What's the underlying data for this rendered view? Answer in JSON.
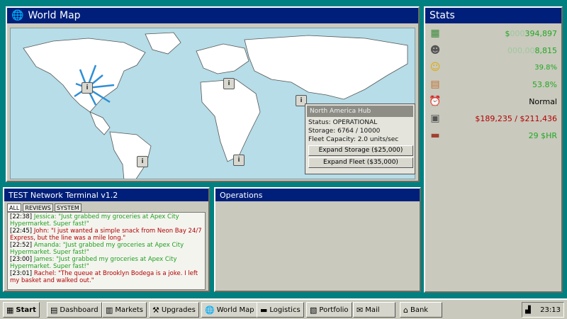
{
  "worldmap": {
    "title": "World Map",
    "popup": {
      "title": "North America Hub",
      "status": "Status: OPERATIONAL",
      "storage": "Storage: 6764 / 10000",
      "fleet": "Fleet Capacity: 2.0 units/sec",
      "expand_storage": "Expand Storage ($25,000)",
      "expand_fleet": "Expand Fleet ($35,000)"
    }
  },
  "stats": {
    "title": "Stats",
    "cash_prefix": "$",
    "cash_dim": "000",
    "cash_value": "394,897",
    "units_dim": "000,00",
    "units_value": "8,815",
    "happiness": "39.8%",
    "growth": "53.8%",
    "speed": "Normal",
    "storage": "$189,235 / $211,436",
    "rate": "29 $HR"
  },
  "terminal": {
    "title": "TEST Network Terminal v1.2",
    "tabs": [
      "ALL",
      "REVIEWS",
      "SYSTEM"
    ],
    "log": [
      {
        "time": "[22:38]",
        "text": "Jessica: \"Just grabbed my groceries at Apex City Hypermarket. Super fast!\"",
        "tone": "good"
      },
      {
        "time": "[22:45]",
        "text": "John: \"I just wanted a simple snack from Neon Bay 24/7 Express, but the line was a mile long.\"",
        "tone": "bad"
      },
      {
        "time": "[22:52]",
        "text": "Amanda: \"Just grabbed my groceries at Apex City Hypermarket. Super fast!\"",
        "tone": "good"
      },
      {
        "time": "[23:00]",
        "text": "James: \"Just grabbed my groceries at Apex City Hypermarket. Super fast!\"",
        "tone": "good"
      },
      {
        "time": "[23:01]",
        "text": "Rachel: \"The queue at Brooklyn Bodega is a joke. I left my basket and walked out.\"",
        "tone": "bad"
      }
    ]
  },
  "operations": {
    "title": "Operations"
  },
  "taskbar": {
    "start": "Start",
    "items": [
      "Dashboard",
      "Markets",
      "Upgrades",
      "World Map",
      "Logistics",
      "Portfolio",
      "Mail",
      "Bank"
    ],
    "clock": "23:13"
  },
  "colors": {
    "titlebar": "#001f7a",
    "desktop": "#008080",
    "good": "#22a822",
    "bad": "#b40000"
  },
  "icons": {
    "worldmap": "globe-icon",
    "cash": "money-icon",
    "units": "people-icon",
    "happiness": "smiley-icon",
    "growth": "chart-icon",
    "speed": "clock-icon",
    "storage": "vault-icon",
    "rate": "briefcase-icon"
  }
}
